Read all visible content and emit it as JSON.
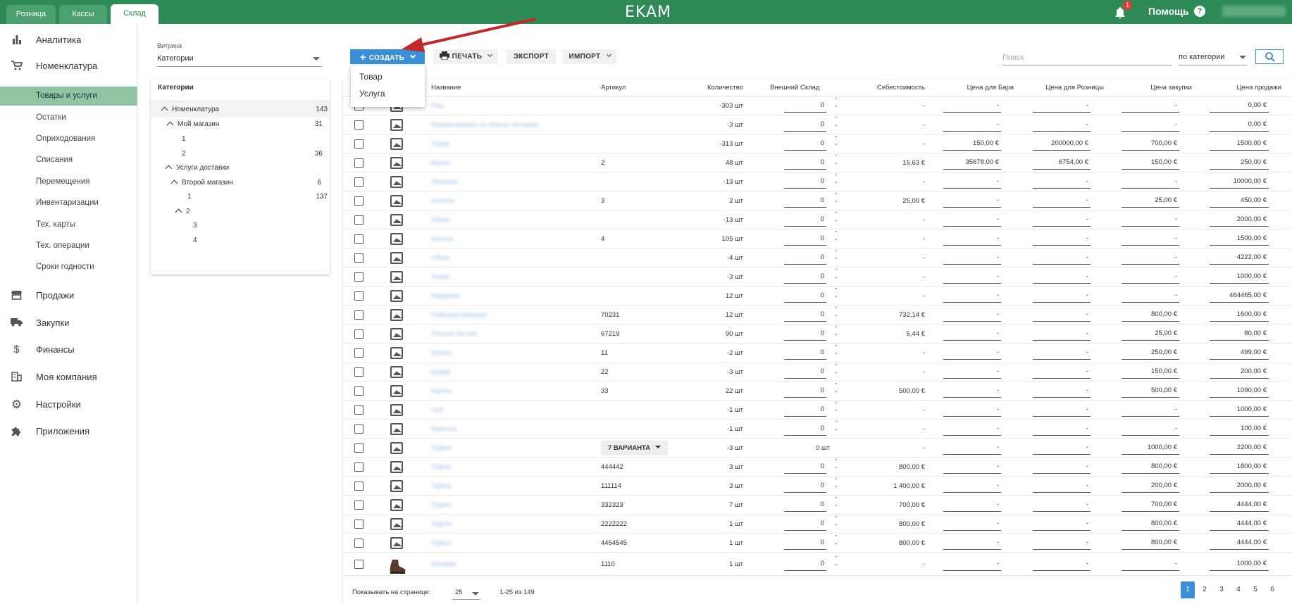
{
  "topbar": {
    "tabs": [
      "Розница",
      "Кассы",
      "Склад"
    ],
    "logo": "EKAM",
    "notif_count": "1",
    "help": "Помощь",
    "help_icon": "?"
  },
  "sidebar": {
    "items": [
      {
        "label": "Аналитика",
        "icon": "bar-chart-icon"
      },
      {
        "label": "Номенклатура",
        "icon": "cart-icon"
      },
      {
        "label": "Продажи",
        "icon": "store-icon"
      },
      {
        "label": "Закупки",
        "icon": "truck-icon"
      },
      {
        "label": "Финансы",
        "icon": "dollar-icon"
      },
      {
        "label": "Моя компания",
        "icon": "building-icon"
      },
      {
        "label": "Настройки",
        "icon": "gear-icon"
      },
      {
        "label": "Приложения",
        "icon": "puzzle-icon"
      }
    ],
    "sub": [
      "Товары и услуги",
      "Остатки",
      "Оприходования",
      "Списания",
      "Перемещения",
      "Инвентаризации",
      "Тех. карты",
      "Тех. операции",
      "Сроки годности"
    ]
  },
  "vitrina": {
    "label": "Витрина",
    "value": "Категории"
  },
  "categories": {
    "header": "Категории",
    "rows": [
      {
        "label": "Номенклатура",
        "count": "143",
        "chev": true
      },
      {
        "label": "Мой магазин",
        "count": "31",
        "chev": true
      },
      {
        "label": "1",
        "count": "",
        "chev": false
      },
      {
        "label": "2",
        "count": "36",
        "chev": false
      },
      {
        "label": "Услуги доставки",
        "count": "",
        "chev": true
      },
      {
        "label": "Второй магазин",
        "count": "6",
        "chev": true
      },
      {
        "label": "1",
        "count": "137",
        "chev": false
      },
      {
        "label": "2",
        "count": "",
        "chev": true
      },
      {
        "label": "3",
        "count": "",
        "chev": false
      },
      {
        "label": "4",
        "count": "",
        "chev": false
      }
    ]
  },
  "toolbar": {
    "create": "СОЗДАТЬ",
    "print": "ПЕЧАТЬ",
    "export": "ЭКСПОРТ",
    "import": "ИМПОРТ",
    "search_placeholder": "Поиск",
    "by_category": "по категории"
  },
  "dropdown": [
    "Товар",
    "Услуга"
  ],
  "table": {
    "headers": [
      "Название",
      "Артикул",
      "Количество",
      "Внешний Склад",
      "Себестоимость",
      "Цена для Бара",
      "Цена для Розницы",
      "Цена закупки",
      "Цена продажи"
    ],
    "rows": [
      {
        "name": "Пиц",
        "art": "",
        "qty": "-303 шт",
        "ext": "0",
        "cost": "-",
        "bar": "-",
        "retail": "-",
        "buy": "-",
        "sell": "0,00 €"
      },
      {
        "name": "Наименование из поиска тестовое",
        "art": "",
        "qty": "-3 шт",
        "ext": "0",
        "cost": "-",
        "bar": "-",
        "retail": "-",
        "buy": "-",
        "sell": "0,00 €"
      },
      {
        "name": "Товар",
        "art": "",
        "qty": "-313 шт",
        "ext": "0",
        "cost": "-",
        "bar": "150,00 €",
        "retail": "200000,00 €",
        "buy": "700,00 €",
        "sell": "1500,00 €"
      },
      {
        "name": "Вилка",
        "art": "2",
        "qty": "48 шт",
        "ext": "0",
        "cost": "15,63 €",
        "bar": "35678,00 €",
        "retail": "6754,00 €",
        "buy": "150,00 €",
        "sell": "250,00 €"
      },
      {
        "name": "Позиция",
        "art": "",
        "qty": "-13 шт",
        "ext": "0",
        "cost": "-",
        "bar": "-",
        "retail": "-",
        "buy": "-",
        "sell": "10000,00 €"
      },
      {
        "name": "Штучка",
        "art": "3",
        "qty": "2 шт",
        "ext": "0",
        "cost": "25,00 €",
        "bar": "-",
        "retail": "-",
        "buy": "25,00 €",
        "sell": "450,00 €"
      },
      {
        "name": "Обувь",
        "art": "",
        "qty": "-13 шт",
        "ext": "0",
        "cost": "-",
        "bar": "-",
        "retail": "-",
        "buy": "-",
        "sell": "2000,00 €"
      },
      {
        "name": "Кроссы",
        "art": "4",
        "qty": "105 шт",
        "ext": "0",
        "cost": "-",
        "bar": "-",
        "retail": "-",
        "buy": "-",
        "sell": "1500,00 €"
      },
      {
        "name": "Обувь",
        "art": "",
        "qty": "-4 шт",
        "ext": "0",
        "cost": "-",
        "bar": "-",
        "retail": "-",
        "buy": "-",
        "sell": "4222,00 €"
      },
      {
        "name": "Товар",
        "art": "",
        "qty": "-3 шт",
        "ext": "0",
        "cost": "-",
        "bar": "-",
        "retail": "-",
        "buy": "-",
        "sell": "1000,00 €"
      },
      {
        "name": "Кардиган",
        "art": "",
        "qty": "12 шт",
        "ext": "0",
        "cost": "-",
        "bar": "-",
        "retail": "-",
        "buy": "-",
        "sell": "464465,00 €"
      },
      {
        "name": "Рубашка мужская",
        "art": "70231",
        "qty": "12 шт",
        "ext": "0",
        "cost": "732,14 €",
        "bar": "-",
        "retail": "-",
        "buy": "800,00 €",
        "sell": "1600,00 €"
      },
      {
        "name": "Платье летнее",
        "art": "67219",
        "qty": "90 шт",
        "ext": "0",
        "cost": "5,44 €",
        "bar": "-",
        "retail": "-",
        "buy": "25,00 €",
        "sell": "80,00 €"
      },
      {
        "name": "Шапка",
        "art": "11",
        "qty": "-2 шт",
        "ext": "0",
        "cost": "-",
        "bar": "-",
        "retail": "-",
        "buy": "250,00 €",
        "sell": "499,00 €"
      },
      {
        "name": "Шарф",
        "art": "22",
        "qty": "-3 шт",
        "ext": "0",
        "cost": "-",
        "bar": "-",
        "retail": "-",
        "buy": "150,00 €",
        "sell": "200,00 €"
      },
      {
        "name": "Куртка",
        "art": "33",
        "qty": "22 шт",
        "ext": "0",
        "cost": "500,00 €",
        "bar": "-",
        "retail": "-",
        "buy": "500,00 €",
        "sell": "1090,00 €"
      },
      {
        "name": "Чай",
        "art": "",
        "qty": "-1 шт",
        "ext": "0",
        "cost": "-",
        "bar": "-",
        "retail": "-",
        "buy": "-",
        "sell": "1000,00 €"
      },
      {
        "name": "Напиток",
        "art": "",
        "qty": "-1 шт",
        "ext": "0",
        "cost": "-",
        "bar": "-",
        "retail": "-",
        "buy": "-",
        "sell": "100,00 €"
      },
      {
        "name": "Туфли",
        "art": "7 ВАРИАНТА",
        "qty": "-3 шт",
        "ext": "0 шт",
        "cost": "-",
        "bar": "-",
        "retail": "-",
        "buy": "1000,00 €",
        "sell": "2200,00 €",
        "variant": true
      },
      {
        "name": "Туфли",
        "art": "444442",
        "qty": "3 шт",
        "ext": "0",
        "cost": "800,00 €",
        "bar": "-",
        "retail": "-",
        "buy": "800,00 €",
        "sell": "1800,00 €"
      },
      {
        "name": "Туфли",
        "art": "111114",
        "qty": "3 шт",
        "ext": "0",
        "cost": "1 400,00 €",
        "bar": "-",
        "retail": "-",
        "buy": "200,00 €",
        "sell": "2000,00 €"
      },
      {
        "name": "Туфли",
        "art": "332323",
        "qty": "7 шт",
        "ext": "0",
        "cost": "700,00 €",
        "bar": "-",
        "retail": "-",
        "buy": "700,00 €",
        "sell": "4444,00 €"
      },
      {
        "name": "Туфли",
        "art": "2222222",
        "qty": "1 шт",
        "ext": "0",
        "cost": "800,00 €",
        "bar": "-",
        "retail": "-",
        "buy": "800,00 €",
        "sell": "4444,00 €"
      },
      {
        "name": "Туфли",
        "art": "4454545",
        "qty": "1 шт",
        "ext": "0",
        "cost": "800,00 €",
        "bar": "-",
        "retail": "-",
        "buy": "800,00 €",
        "sell": "4444,00 €"
      },
      {
        "name": "Ботинки",
        "art": "1110",
        "qty": "1 шт",
        "ext": "0",
        "cost": "-",
        "bar": "-",
        "retail": "-",
        "buy": "-",
        "sell": "1000,00 €",
        "photo": true
      }
    ]
  },
  "footer": {
    "per_page_label": "Показывать на странице:",
    "per_page": "25",
    "range": "1-25 из 149",
    "pages": [
      "1",
      "2",
      "3",
      "4",
      "5",
      "6"
    ],
    "current_page": "1"
  }
}
